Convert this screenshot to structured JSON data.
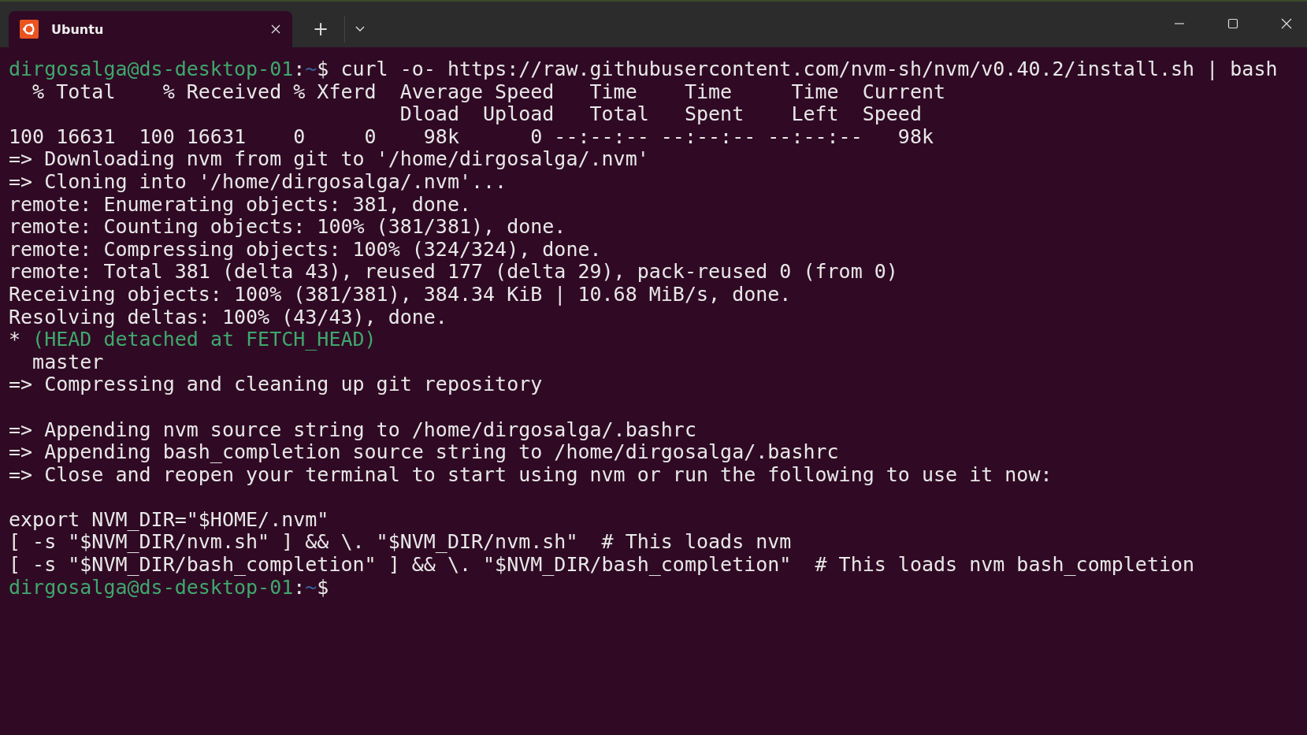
{
  "tabs": [
    {
      "title": "Ubuntu",
      "selected": true
    }
  ],
  "tab_bar": {
    "new_tab": "+"
  },
  "terminal": {
    "lines": [
      {
        "segments": [
          {
            "kind": "host",
            "text": "dirgosalga@ds-desktop-01"
          },
          {
            "kind": "plain",
            "text": ":"
          },
          {
            "kind": "path",
            "text": "~"
          },
          {
            "kind": "plain",
            "text": "$ curl -o- https://raw.githubusercontent.com/nvm-sh/nvm/v0.40.2/install.sh | bash"
          }
        ]
      },
      {
        "segments": [
          {
            "kind": "plain",
            "text": "  % Total    % Received % Xferd  Average Speed   Time    Time     Time  Current"
          }
        ]
      },
      {
        "segments": [
          {
            "kind": "plain",
            "text": "                                 Dload  Upload   Total   Spent    Left  Speed"
          }
        ]
      },
      {
        "segments": [
          {
            "kind": "plain",
            "text": "100 16631  100 16631    0     0    98k      0 --:--:-- --:--:-- --:--:--   98k"
          }
        ]
      },
      {
        "segments": [
          {
            "kind": "plain",
            "text": "=> Downloading nvm from git to '/home/dirgosalga/.nvm'"
          }
        ]
      },
      {
        "segments": [
          {
            "kind": "plain",
            "text": "=> Cloning into '/home/dirgosalga/.nvm'..."
          }
        ]
      },
      {
        "segments": [
          {
            "kind": "plain",
            "text": "remote: Enumerating objects: 381, done."
          }
        ]
      },
      {
        "segments": [
          {
            "kind": "plain",
            "text": "remote: Counting objects: 100% (381/381), done."
          }
        ]
      },
      {
        "segments": [
          {
            "kind": "plain",
            "text": "remote: Compressing objects: 100% (324/324), done."
          }
        ]
      },
      {
        "segments": [
          {
            "kind": "plain",
            "text": "remote: Total 381 (delta 43), reused 177 (delta 29), pack-reused 0 (from 0)"
          }
        ]
      },
      {
        "segments": [
          {
            "kind": "plain",
            "text": "Receiving objects: 100% (381/381), 384.34 KiB | 10.68 MiB/s, done."
          }
        ]
      },
      {
        "segments": [
          {
            "kind": "plain",
            "text": "Resolving deltas: 100% (43/43), done."
          }
        ]
      },
      {
        "segments": [
          {
            "kind": "plain",
            "text": "* "
          },
          {
            "kind": "host",
            "text": "(HEAD detached at FETCH_HEAD)"
          }
        ]
      },
      {
        "segments": [
          {
            "kind": "plain",
            "text": "  master"
          }
        ]
      },
      {
        "segments": [
          {
            "kind": "plain",
            "text": "=> Compressing and cleaning up git repository"
          }
        ]
      },
      {
        "kind": "blank"
      },
      {
        "segments": [
          {
            "kind": "plain",
            "text": "=> Appending nvm source string to /home/dirgosalga/.bashrc"
          }
        ]
      },
      {
        "segments": [
          {
            "kind": "plain",
            "text": "=> Appending bash_completion source string to /home/dirgosalga/.bashrc"
          }
        ]
      },
      {
        "segments": [
          {
            "kind": "plain",
            "text": "=> Close and reopen your terminal to start using nvm or run the following to use it now:"
          }
        ]
      },
      {
        "kind": "blank"
      },
      {
        "segments": [
          {
            "kind": "plain",
            "text": "export NVM_DIR=\"$HOME/.nvm\""
          }
        ]
      },
      {
        "segments": [
          {
            "kind": "plain",
            "text": "[ -s \"$NVM_DIR/nvm.sh\" ] && \\. \"$NVM_DIR/nvm.sh\"  # This loads nvm"
          }
        ]
      },
      {
        "segments": [
          {
            "kind": "plain",
            "text": "[ -s \"$NVM_DIR/bash_completion\" ] && \\. \"$NVM_DIR/bash_completion\"  # This loads nvm bash_completion"
          }
        ]
      },
      {
        "segments": [
          {
            "kind": "host",
            "text": "dirgosalga@ds-desktop-01"
          },
          {
            "kind": "plain",
            "text": ":"
          },
          {
            "kind": "path",
            "text": "~"
          },
          {
            "kind": "plain",
            "text": "$"
          }
        ]
      }
    ]
  }
}
